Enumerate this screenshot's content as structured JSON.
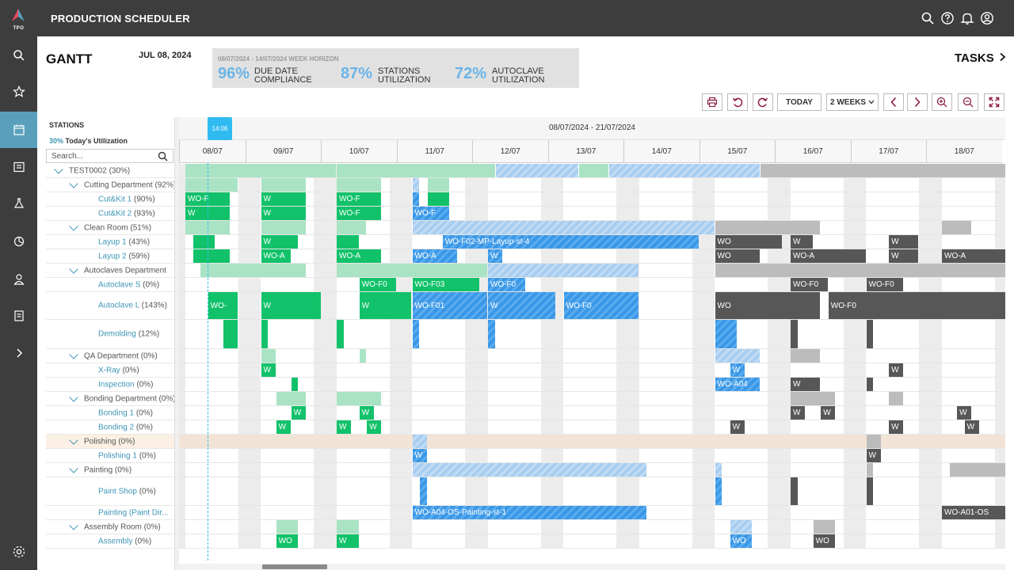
{
  "app": {
    "logo_text": "TPO",
    "title": "PRODUCTION SCHEDULER"
  },
  "colors": {
    "accent": "#5aa0bc",
    "kpi": "#6ab4e8",
    "now": "#2fbbf0",
    "green": "#12c26a",
    "blue": "#3a97e6",
    "dark": "#575757"
  },
  "sidebar": {
    "items": [
      {
        "icon": "search-icon"
      },
      {
        "icon": "star-icon"
      },
      {
        "icon": "calendar-icon",
        "active": true
      },
      {
        "icon": "list-check-icon"
      },
      {
        "icon": "flask-icon"
      },
      {
        "icon": "chart-icon"
      },
      {
        "icon": "user-icon"
      },
      {
        "icon": "document-icon"
      },
      {
        "icon": "expand-icon"
      },
      {
        "icon": "settings-icon"
      }
    ]
  },
  "topbar": {
    "icons": [
      "search-icon",
      "help-icon",
      "bell-icon",
      "account-icon"
    ]
  },
  "header": {
    "title": "GANTT",
    "date": "JUL 08, 2024",
    "tasks_label": "TASKS"
  },
  "kpi": {
    "horizon": "08/07/2024 - 14/07/2024 WEEK HORIZON",
    "items": [
      {
        "value": "96%",
        "label1": "DUE DATE",
        "label2": "COMPLIANCE"
      },
      {
        "value": "87%",
        "label1": "STATIONS",
        "label2": "UTILIZATION"
      },
      {
        "value": "72%",
        "label1": "AUTOCLAVE",
        "label2": "UTILIZATION"
      }
    ]
  },
  "toolbar": {
    "today_label": "TODAY",
    "range_select": "2 WEEKS"
  },
  "left_panel": {
    "header": "STATIONS",
    "util_pct": "30%",
    "util_label": "Today's Utilization",
    "search_placeholder": "Search..."
  },
  "timeline": {
    "range": "08/07/2024 - 21/07/2024",
    "now_time": "14:06",
    "days": [
      "08/07",
      "09/07",
      "10/07",
      "11/07",
      "12/07",
      "13/07",
      "14/07",
      "15/07",
      "16/07",
      "17/07",
      "18/07"
    ]
  },
  "rows": [
    {
      "kind": "group",
      "level": 0,
      "name": "TEST0002",
      "pct": "(30%)"
    },
    {
      "kind": "group",
      "level": 1,
      "name": "Cutting Department",
      "pct": "(92%)"
    },
    {
      "kind": "station",
      "name": "Cut&Kit 1",
      "pct": "(90%)"
    },
    {
      "kind": "station",
      "name": "Cut&Kit 2",
      "pct": "(93%)"
    },
    {
      "kind": "group",
      "level": 1,
      "name": "Clean Room",
      "pct": "(51%)"
    },
    {
      "kind": "station",
      "name": "Layup 1",
      "pct": "(43%)"
    },
    {
      "kind": "station",
      "name": "Layup 2",
      "pct": "(59%)"
    },
    {
      "kind": "group",
      "level": 1,
      "name": "Autoclaves Department",
      "pct": ""
    },
    {
      "kind": "station",
      "name": "Autoclave S",
      "pct": "(0%)"
    },
    {
      "kind": "station",
      "name": "Autoclave L",
      "pct": "(143%)"
    },
    {
      "kind": "station",
      "name": "Demolding",
      "pct": "(12%)"
    },
    {
      "kind": "group",
      "level": 1,
      "name": "QA Department",
      "pct": "(0%)"
    },
    {
      "kind": "station",
      "name": "X-Ray",
      "pct": "(0%)"
    },
    {
      "kind": "station",
      "name": "Inspection",
      "pct": "(0%)"
    },
    {
      "kind": "group",
      "level": 1,
      "name": "Bonding Department",
      "pct": "(0%)"
    },
    {
      "kind": "station",
      "name": "Bonding 1",
      "pct": "(0%)"
    },
    {
      "kind": "station",
      "name": "Bonding 2",
      "pct": "(0%)"
    },
    {
      "kind": "group",
      "level": 1,
      "name": "Polishing",
      "pct": "(0%)",
      "highlight": true
    },
    {
      "kind": "station",
      "name": "Polishing 1",
      "pct": "(0%)"
    },
    {
      "kind": "group",
      "level": 1,
      "name": "Painting",
      "pct": "(0%)"
    },
    {
      "kind": "station",
      "name": "Paint Shop",
      "pct": "(0%)"
    },
    {
      "kind": "station",
      "name": "Painting (Paint Dir...",
      "pct": ""
    },
    {
      "kind": "group",
      "level": 1,
      "name": "Assembly Room",
      "pct": "(0%)"
    },
    {
      "kind": "station",
      "name": "Assembly",
      "pct": "(0%)"
    }
  ],
  "bars": [
    {
      "row": 0,
      "day": 0.0,
      "len": 2.0,
      "c": "lg"
    },
    {
      "row": 0,
      "day": 2.0,
      "len": 2.1,
      "c": "lg"
    },
    {
      "row": 0,
      "day": 4.1,
      "len": 1.1,
      "c": "lb"
    },
    {
      "row": 0,
      "day": 5.2,
      "len": 0.4,
      "c": "lg"
    },
    {
      "row": 0,
      "day": 5.6,
      "len": 2.0,
      "c": "lb"
    },
    {
      "row": 0,
      "day": 7.6,
      "len": 3.9,
      "c": "ld"
    },
    {
      "row": 1,
      "day": 0.0,
      "len": 0.7,
      "c": "lg"
    },
    {
      "row": 1,
      "day": 1.0,
      "len": 0.6,
      "c": "lg"
    },
    {
      "row": 1,
      "day": 2.0,
      "len": 0.6,
      "c": "lg"
    },
    {
      "row": 1,
      "day": 3.0,
      "len": 0.1,
      "c": "lb"
    },
    {
      "row": 1,
      "day": 3.2,
      "len": 0.3,
      "c": "lg"
    },
    {
      "row": 2,
      "day": 0.0,
      "len": 0.6,
      "c": "g",
      "t": "WO-F"
    },
    {
      "row": 2,
      "day": 1.0,
      "len": 0.6,
      "c": "g",
      "t": "W"
    },
    {
      "row": 2,
      "day": 2.0,
      "len": 0.6,
      "c": "g",
      "t": "WO-F"
    },
    {
      "row": 2,
      "day": 3.0,
      "len": 0.1,
      "c": "b"
    },
    {
      "row": 2,
      "day": 3.2,
      "len": 0.3,
      "c": "g"
    },
    {
      "row": 3,
      "day": 0.0,
      "len": 0.6,
      "c": "g",
      "t": "W"
    },
    {
      "row": 3,
      "day": 1.0,
      "len": 0.6,
      "c": "g",
      "t": "W"
    },
    {
      "row": 3,
      "day": 2.0,
      "len": 0.6,
      "c": "g",
      "t": "WO-F"
    },
    {
      "row": 3,
      "day": 3.0,
      "len": 0.5,
      "c": "b",
      "t": "WO-F"
    },
    {
      "row": 4,
      "day": 0.0,
      "len": 0.6,
      "c": "lg"
    },
    {
      "row": 4,
      "day": 1.0,
      "len": 0.6,
      "c": "lg"
    },
    {
      "row": 4,
      "day": 2.0,
      "len": 0.4,
      "c": "lg"
    },
    {
      "row": 4,
      "day": 3.0,
      "len": 4.0,
      "c": "lb"
    },
    {
      "row": 4,
      "day": 7.0,
      "len": 1.4,
      "c": "ld"
    },
    {
      "row": 4,
      "day": 10.0,
      "len": 0.4,
      "c": "ld"
    },
    {
      "row": 5,
      "day": 0.1,
      "len": 0.3,
      "c": "g"
    },
    {
      "row": 5,
      "day": 1.0,
      "len": 0.5,
      "c": "g",
      "t": "W"
    },
    {
      "row": 5,
      "day": 2.0,
      "len": 0.3,
      "c": "g"
    },
    {
      "row": 5,
      "day": 3.4,
      "len": 3.4,
      "c": "b",
      "t": "WO-F02-MP-Layup-st-4"
    },
    {
      "row": 5,
      "day": 7.0,
      "len": 0.9,
      "c": "d",
      "t": "WO"
    },
    {
      "row": 5,
      "day": 8.0,
      "len": 0.3,
      "c": "d",
      "t": "W"
    },
    {
      "row": 5,
      "day": 9.3,
      "len": 0.4,
      "c": "d",
      "t": "W"
    },
    {
      "row": 6,
      "day": 0.1,
      "len": 0.5,
      "c": "g"
    },
    {
      "row": 6,
      "day": 1.0,
      "len": 0.4,
      "c": "g",
      "t": "WO-A"
    },
    {
      "row": 6,
      "day": 2.0,
      "len": 0.6,
      "c": "g",
      "t": "WO-A"
    },
    {
      "row": 6,
      "day": 3.0,
      "len": 0.6,
      "c": "b",
      "t": "WO-A"
    },
    {
      "row": 6,
      "day": 4.0,
      "len": 0.2,
      "c": "b",
      "t": "W"
    },
    {
      "row": 6,
      "day": 7.0,
      "len": 0.6,
      "c": "d",
      "t": "WO"
    },
    {
      "row": 6,
      "day": 8.0,
      "len": 1.0,
      "c": "d",
      "t": "WO-A"
    },
    {
      "row": 6,
      "day": 9.3,
      "len": 0.4,
      "c": "d",
      "t": "W"
    },
    {
      "row": 6,
      "day": 10.0,
      "len": 0.9,
      "c": "d",
      "t": "WO-A"
    },
    {
      "row": 7,
      "day": 0.2,
      "len": 1.4,
      "c": "lg"
    },
    {
      "row": 7,
      "day": 2.0,
      "len": 2.0,
      "c": "lg"
    },
    {
      "row": 7,
      "day": 4.0,
      "len": 2.0,
      "c": "lb"
    },
    {
      "row": 7,
      "day": 7.0,
      "len": 4.0,
      "c": "ld"
    },
    {
      "row": 8,
      "day": 2.3,
      "len": 0.5,
      "c": "g",
      "t": "WO-F0"
    },
    {
      "row": 8,
      "day": 3.0,
      "len": 0.9,
      "c": "g",
      "t": "WO-F03"
    },
    {
      "row": 8,
      "day": 4.0,
      "len": 0.5,
      "c": "b",
      "t": "WO-F0"
    },
    {
      "row": 8,
      "day": 8.0,
      "len": 0.5,
      "c": "d",
      "t": "WO-F0"
    },
    {
      "row": 8,
      "day": 9.0,
      "len": 0.5,
      "c": "d",
      "t": "WO-F0"
    },
    {
      "row": 9,
      "day": 0.3,
      "len": 0.4,
      "c": "g",
      "t": "WO-"
    },
    {
      "row": 9,
      "day": 1.0,
      "len": 0.8,
      "c": "g",
      "t": "W"
    },
    {
      "row": 9,
      "day": 2.3,
      "len": 0.7,
      "c": "g",
      "t": "W"
    },
    {
      "row": 9,
      "day": 3.0,
      "len": 1.0,
      "c": "b",
      "t": "WO-F01"
    },
    {
      "row": 9,
      "day": 4.0,
      "len": 0.9,
      "c": "b",
      "t": "W"
    },
    {
      "row": 9,
      "day": 5.0,
      "len": 1.0,
      "c": "b",
      "t": "WO-F0"
    },
    {
      "row": 9,
      "day": 7.0,
      "len": 1.4,
      "c": "d",
      "t": "WO"
    },
    {
      "row": 9,
      "day": 8.5,
      "len": 2.8,
      "c": "d",
      "t": "WO-F0"
    },
    {
      "row": 10,
      "day": 0.5,
      "len": 0.2,
      "c": "g"
    },
    {
      "row": 10,
      "day": 1.0,
      "len": 0.1,
      "c": "g"
    },
    {
      "row": 10,
      "day": 2.0,
      "len": 0.1,
      "c": "g"
    },
    {
      "row": 10,
      "day": 3.0,
      "len": 0.1,
      "c": "b"
    },
    {
      "row": 10,
      "day": 4.0,
      "len": 0.1,
      "c": "b"
    },
    {
      "row": 10,
      "day": 7.0,
      "len": 0.3,
      "c": "b"
    },
    {
      "row": 10,
      "day": 8.0,
      "len": 0.1,
      "c": "d"
    },
    {
      "row": 10,
      "day": 9.0,
      "len": 0.1,
      "c": "d"
    },
    {
      "row": 11,
      "day": 1.0,
      "len": 0.2,
      "c": "lg"
    },
    {
      "row": 11,
      "day": 2.3,
      "len": 0.1,
      "c": "lg"
    },
    {
      "row": 11,
      "day": 7.0,
      "len": 0.6,
      "c": "lb"
    },
    {
      "row": 11,
      "day": 8.0,
      "len": 0.4,
      "c": "ld"
    },
    {
      "row": 12,
      "day": 1.0,
      "len": 0.2,
      "c": "g",
      "t": "W"
    },
    {
      "row": 12,
      "day": 7.2,
      "len": 0.2,
      "c": "b",
      "t": "W"
    },
    {
      "row": 12,
      "day": 9.3,
      "len": 0.2,
      "c": "d",
      "t": "W"
    },
    {
      "row": 13,
      "day": 1.4,
      "len": 0.1,
      "c": "g"
    },
    {
      "row": 13,
      "day": 7.0,
      "len": 0.6,
      "c": "b",
      "t": "WO-A04"
    },
    {
      "row": 13,
      "day": 8.0,
      "len": 0.4,
      "c": "d",
      "t": "W"
    },
    {
      "row": 13,
      "day": 9.0,
      "len": 0.1,
      "c": "d"
    },
    {
      "row": 14,
      "day": 1.2,
      "len": 0.4,
      "c": "lg"
    },
    {
      "row": 14,
      "day": 2.0,
      "len": 0.6,
      "c": "lg"
    },
    {
      "row": 14,
      "day": 8.0,
      "len": 0.6,
      "c": "ld"
    },
    {
      "row": 14,
      "day": 9.3,
      "len": 0.2,
      "c": "ld"
    },
    {
      "row": 15,
      "day": 1.4,
      "len": 0.2,
      "c": "g",
      "t": "W"
    },
    {
      "row": 15,
      "day": 2.3,
      "len": 0.2,
      "c": "g",
      "t": "W"
    },
    {
      "row": 15,
      "day": 8.0,
      "len": 0.2,
      "c": "d",
      "t": "W"
    },
    {
      "row": 15,
      "day": 8.4,
      "len": 0.2,
      "c": "d",
      "t": "W"
    },
    {
      "row": 15,
      "day": 10.2,
      "len": 0.2,
      "c": "d",
      "t": "W"
    },
    {
      "row": 16,
      "day": 1.2,
      "len": 0.2,
      "c": "g",
      "t": "W"
    },
    {
      "row": 16,
      "day": 2.0,
      "len": 0.2,
      "c": "g",
      "t": "W"
    },
    {
      "row": 16,
      "day": 2.4,
      "len": 0.2,
      "c": "g",
      "t": "W"
    },
    {
      "row": 16,
      "day": 7.2,
      "len": 0.2,
      "c": "d",
      "t": "W"
    },
    {
      "row": 16,
      "day": 9.3,
      "len": 0.2,
      "c": "d",
      "t": "W"
    },
    {
      "row": 16,
      "day": 10.3,
      "len": 0.2,
      "c": "d",
      "t": "W"
    },
    {
      "row": 17,
      "day": 3.0,
      "len": 0.2,
      "c": "lb"
    },
    {
      "row": 17,
      "day": 9.0,
      "len": 0.2,
      "c": "ld"
    },
    {
      "row": 18,
      "day": 3.0,
      "len": 0.2,
      "c": "b",
      "t": "W"
    },
    {
      "row": 18,
      "day": 9.0,
      "len": 0.2,
      "c": "d",
      "t": "W"
    },
    {
      "row": 19,
      "day": 3.0,
      "len": 3.1,
      "c": "lb"
    },
    {
      "row": 19,
      "day": 7.0,
      "len": 0.1,
      "c": "lb"
    },
    {
      "row": 19,
      "day": 9.0,
      "len": 0.1,
      "c": "ld"
    },
    {
      "row": 19,
      "day": 10.1,
      "len": 0.8,
      "c": "ld"
    },
    {
      "row": 20,
      "day": 3.1,
      "len": 0.1,
      "c": "b"
    },
    {
      "row": 20,
      "day": 7.0,
      "len": 0.1,
      "c": "b"
    },
    {
      "row": 20,
      "day": 8.0,
      "len": 0.1,
      "c": "d"
    },
    {
      "row": 20,
      "day": 9.0,
      "len": 0.1,
      "c": "d"
    },
    {
      "row": 21,
      "day": 3.0,
      "len": 3.1,
      "c": "b",
      "t": "WO-A04-OS-Painting-st-1"
    },
    {
      "row": 21,
      "day": 10.0,
      "len": 1.0,
      "c": "d",
      "t": "WO-A01-OS"
    },
    {
      "row": 22,
      "day": 1.2,
      "len": 0.3,
      "c": "lg"
    },
    {
      "row": 22,
      "day": 2.0,
      "len": 0.3,
      "c": "lg"
    },
    {
      "row": 22,
      "day": 7.2,
      "len": 0.3,
      "c": "lb"
    },
    {
      "row": 22,
      "day": 8.3,
      "len": 0.3,
      "c": "ld"
    },
    {
      "row": 23,
      "day": 1.2,
      "len": 0.3,
      "c": "g",
      "t": "WO"
    },
    {
      "row": 23,
      "day": 2.0,
      "len": 0.3,
      "c": "g",
      "t": "W"
    },
    {
      "row": 23,
      "day": 7.2,
      "len": 0.3,
      "c": "b",
      "t": "WO"
    },
    {
      "row": 23,
      "day": 8.3,
      "len": 0.3,
      "c": "d",
      "t": "WO"
    }
  ]
}
